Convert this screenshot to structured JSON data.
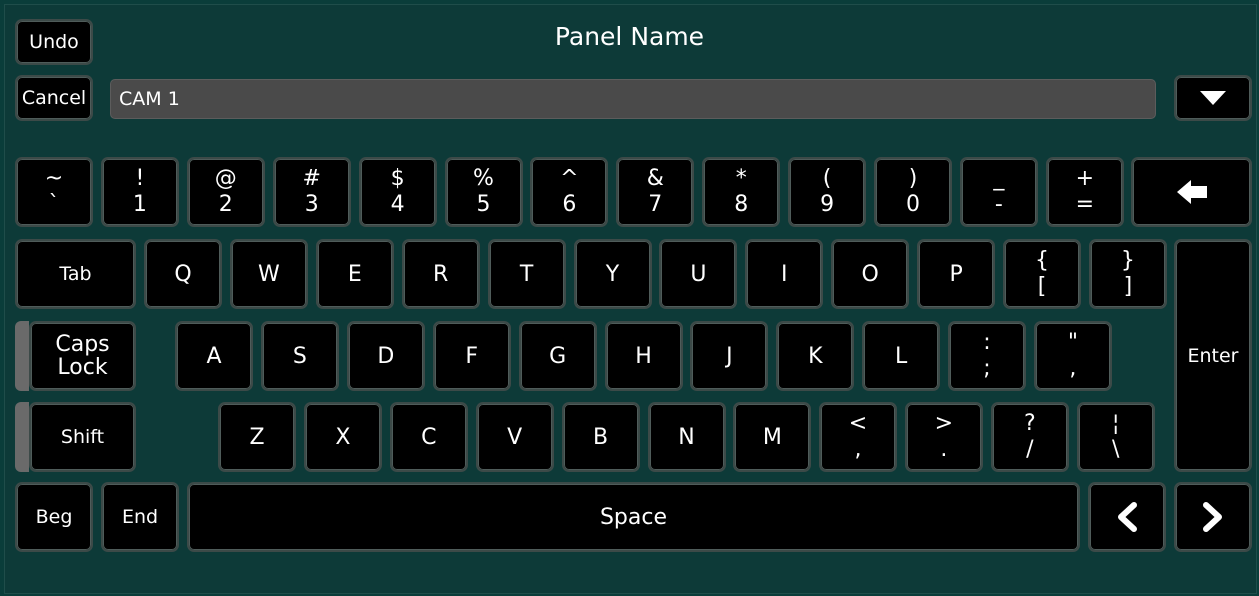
{
  "header": {
    "title": "Panel Name"
  },
  "toolbar": {
    "undo_label": "Undo",
    "cancel_label": "Cancel"
  },
  "input": {
    "value": "CAM 1",
    "dropdown_icon": "triangle-down-icon"
  },
  "row1": [
    {
      "top": "~",
      "bot": "`"
    },
    {
      "top": "!",
      "bot": "1"
    },
    {
      "top": "@",
      "bot": "2"
    },
    {
      "top": "#",
      "bot": "3"
    },
    {
      "top": "$",
      "bot": "4"
    },
    {
      "top": "%",
      "bot": "5"
    },
    {
      "top": "^",
      "bot": "6"
    },
    {
      "top": "&",
      "bot": "7"
    },
    {
      "top": "*",
      "bot": "8"
    },
    {
      "top": "(",
      "bot": "9"
    },
    {
      "top": ")",
      "bot": "0"
    },
    {
      "top": "_",
      "bot": "-"
    },
    {
      "top": "+",
      "bot": "="
    }
  ],
  "backspace_icon": "backspace-arrow-icon",
  "row2": {
    "tab": "Tab",
    "letters": [
      "Q",
      "W",
      "E",
      "R",
      "T",
      "Y",
      "U",
      "I",
      "O",
      "P"
    ],
    "extra": [
      {
        "top": "{",
        "bot": "["
      },
      {
        "top": "}",
        "bot": "]"
      }
    ]
  },
  "row3": {
    "caps_top": "Caps",
    "caps_bot": "Lock",
    "letters": [
      "A",
      "S",
      "D",
      "F",
      "G",
      "H",
      "J",
      "K",
      "L"
    ],
    "extra": [
      {
        "top": ":",
        "bot": ";"
      },
      {
        "top": "\"",
        "bot": ","
      }
    ]
  },
  "row4": {
    "shift": "Shift",
    "letters": [
      "Z",
      "X",
      "C",
      "V",
      "B",
      "N",
      "M"
    ],
    "extra": [
      {
        "top": "<",
        "bot": ","
      },
      {
        "top": ">",
        "bot": "."
      },
      {
        "top": "?",
        "bot": "/"
      },
      {
        "top": "¦",
        "bot": "\\"
      }
    ]
  },
  "enter_label": "Enter",
  "row5": {
    "beg": "Beg",
    "end": "End",
    "space": "Space",
    "left_icon": "chevron-left-icon",
    "right_icon": "chevron-right-icon"
  }
}
